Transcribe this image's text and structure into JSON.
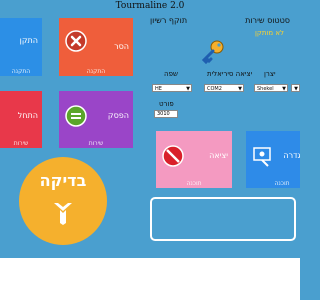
{
  "window": {
    "title": "Tourmaline 2.0"
  },
  "menu": {
    "items": [
      "סטטוס שירות",
      "תוקף רשיון"
    ]
  },
  "status": {
    "text": "לא מותקן"
  },
  "tiles": [
    {
      "id": "install",
      "label": "התקן",
      "sub": "התקנה",
      "color": "#2c8fe6"
    },
    {
      "id": "remove",
      "label": "הסר",
      "sub": "התקנה",
      "color": "#ef5e3b"
    },
    {
      "id": "start",
      "label": "התחל",
      "sub": "שירות",
      "color": "#e8384a"
    },
    {
      "id": "stop",
      "label": "הפסק",
      "sub": "שירות",
      "color": "#9a45c8"
    },
    {
      "id": "exit",
      "label": "יציאה",
      "sub": "תוכנה",
      "color": "#f49ac1"
    },
    {
      "id": "config",
      "label": "הגדרה",
      "sub": "תוכנה",
      "color": "#2e8be8"
    }
  ],
  "settings": {
    "language_label": "שפה",
    "language_value": "HE",
    "serial_label": "יציאה סיריאלית",
    "serial_value": "COM2",
    "maker_label": "יצרן",
    "maker_value": "Shekel",
    "port_label": "פורט",
    "port_value": "3010"
  },
  "check": {
    "label": "בדיקה",
    "icon": "tourmaline-logo-icon"
  },
  "colors": {
    "background": "#4a9fcf",
    "status": "#f5d033",
    "check": "#f5b02d"
  }
}
